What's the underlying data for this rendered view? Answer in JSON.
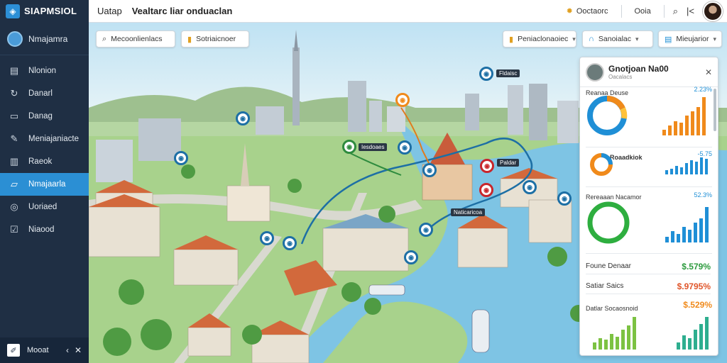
{
  "topbar": {
    "brand": "SIAPMSIOL",
    "nav": [
      "Uatap",
      "Vealtarc liar onduaclan"
    ],
    "right_items": [
      {
        "label": "Ooctaorc",
        "icon": "sun-icon"
      },
      {
        "label": "Ooia",
        "icon": "help-icon"
      }
    ]
  },
  "sidebar": {
    "header": "Nmajamra",
    "items": [
      {
        "label": "Nlonion",
        "icon": "document-icon",
        "active": false
      },
      {
        "label": "Danarl",
        "icon": "refresh-icon",
        "active": false
      },
      {
        "label": "Danag",
        "icon": "window-icon",
        "active": false
      },
      {
        "label": "Meniajaniacte",
        "icon": "edit-icon",
        "active": false
      },
      {
        "label": "Raeok",
        "icon": "book-icon",
        "active": false
      },
      {
        "label": "Nmajaarla",
        "icon": "folder-icon",
        "active": true
      },
      {
        "label": "Uoriaed",
        "icon": "globe-icon",
        "active": false
      },
      {
        "label": "Niaood",
        "icon": "checkbox-icon",
        "active": false
      }
    ],
    "footer": "Mooat"
  },
  "toolbar": {
    "search_placeholder": "Mecoonlienlacs",
    "filter_label": "Sotriaicnoer",
    "dropdown1": "Peniaclonaoiec",
    "dropdown2": "Sanoialac",
    "dropdown3": "Mieujarior"
  },
  "panel": {
    "title": "Gnotjoan Na00",
    "subtitle": "Oacalacs",
    "section1": {
      "title": "Reanaa Deuse",
      "value": "2.23%"
    },
    "section2": {
      "title": "Roaadkiok",
      "value": "-5.75"
    },
    "section3": {
      "title": "Rereaaan Nacamor",
      "value": "52.3%"
    },
    "stats": [
      {
        "label": "Foune Denaar",
        "value": "$.579%",
        "color": "#2e9b3f"
      },
      {
        "label": "Satiar Saics",
        "value": "$.9795%",
        "color": "#e0562b"
      }
    ],
    "section4": {
      "title": "Datlar Socaosnoid",
      "value": "$.529%"
    }
  },
  "map_labels": [
    "Fldaisc",
    "Iesdoaes",
    "Paldar",
    "Naticaricoa"
  ],
  "colors": {
    "sidebar_bg": "#1f2f44",
    "accent": "#2b8fd4",
    "donut_orange": "#f08a1b",
    "donut_blue": "#1f8fd6",
    "donut_green": "#2eae3f"
  }
}
